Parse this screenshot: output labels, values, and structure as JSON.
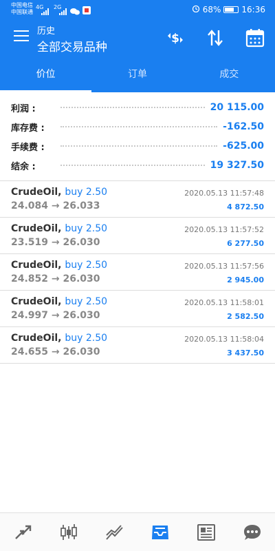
{
  "status_bar": {
    "carrier1": "中国电信",
    "carrier2": "中国联通",
    "net1": "4G",
    "net2": "2G",
    "battery": "68%",
    "time": "16:36"
  },
  "app_bar": {
    "subtitle": "历史",
    "title": "全部交易品种",
    "icons": [
      "menu-icon",
      "currency-sort-icon",
      "sort-arrows-icon",
      "calendar-icon"
    ]
  },
  "tabs": [
    {
      "label": "价位",
      "active": true
    },
    {
      "label": "订单",
      "active": false
    },
    {
      "label": "成交",
      "active": false
    }
  ],
  "summary": [
    {
      "label": "利润 :",
      "value": "20 115.00"
    },
    {
      "label": "库存费 :",
      "value": "-162.50"
    },
    {
      "label": "手续费 :",
      "value": "-625.00"
    },
    {
      "label": "结余 :",
      "value": "19 327.50"
    }
  ],
  "deals": [
    {
      "symbol": "CrudeOil,",
      "side": "buy 2.50",
      "prices": "24.084 → 26.033",
      "time": "2020.05.13 11:57:48",
      "profit": "4 872.50"
    },
    {
      "symbol": "CrudeOil,",
      "side": "buy 2.50",
      "prices": "23.519 → 26.030",
      "time": "2020.05.13 11:57:52",
      "profit": "6 277.50"
    },
    {
      "symbol": "CrudeOil,",
      "side": "buy 2.50",
      "prices": "24.852 → 26.030",
      "time": "2020.05.13 11:57:56",
      "profit": "2 945.00"
    },
    {
      "symbol": "CrudeOil,",
      "side": "buy 2.50",
      "prices": "24.997 → 26.030",
      "time": "2020.05.13 11:58:01",
      "profit": "2 582.50"
    },
    {
      "symbol": "CrudeOil,",
      "side": "buy 2.50",
      "prices": "24.655 → 26.030",
      "time": "2020.05.13 11:58:04",
      "profit": "3 437.50"
    }
  ],
  "bottom_nav": [
    {
      "icon": "trade-arrows-icon",
      "active": false
    },
    {
      "icon": "candlestick-chart-icon",
      "active": false
    },
    {
      "icon": "line-chart-icon",
      "active": false
    },
    {
      "icon": "history-inbox-icon",
      "active": true
    },
    {
      "icon": "news-icon",
      "active": false
    },
    {
      "icon": "chat-icon",
      "active": false
    }
  ],
  "colors": {
    "accent": "#1a7ff0",
    "inactive_icon": "#666666"
  }
}
